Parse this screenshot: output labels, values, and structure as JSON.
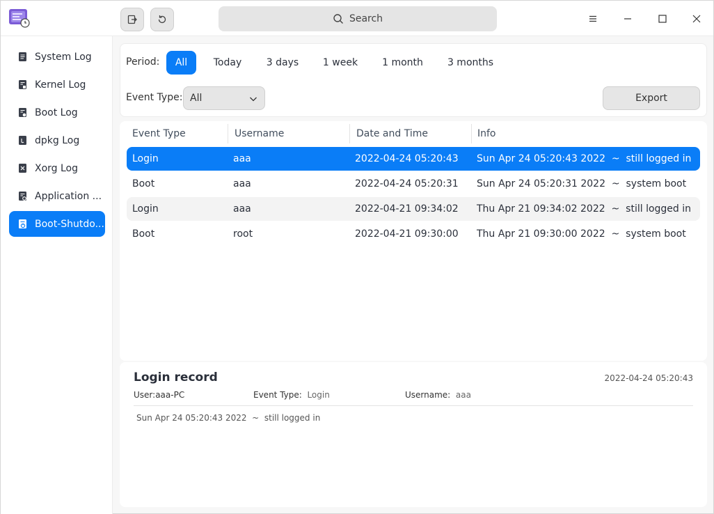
{
  "toolbar": {
    "search_placeholder": "Search"
  },
  "sidebar": {
    "items": [
      {
        "label": "System Log",
        "icon": "system-log-icon"
      },
      {
        "label": "Kernel Log",
        "icon": "kernel-log-icon"
      },
      {
        "label": "Boot Log",
        "icon": "boot-log-icon"
      },
      {
        "label": "dpkg Log",
        "icon": "dpkg-log-icon"
      },
      {
        "label": "Xorg Log",
        "icon": "xorg-log-icon"
      },
      {
        "label": "Application ...",
        "icon": "application-log-icon"
      },
      {
        "label": "Boot-Shutdo...",
        "icon": "boot-shutdown-log-icon",
        "active": true
      }
    ]
  },
  "filter": {
    "period_label": "Period:",
    "periods": [
      "All",
      "Today",
      "3 days",
      "1 week",
      "1 month",
      "3 months"
    ],
    "selected_period": "All",
    "event_type_label": "Event Type:",
    "event_type_value": "All",
    "export_label": "Export"
  },
  "table": {
    "headers": [
      "Event Type",
      "Username",
      "Date and Time",
      "Info"
    ],
    "rows": [
      {
        "event": "Login",
        "user": "aaa",
        "datetime": "2022-04-24 05:20:43",
        "info": "Sun Apr 24 05:20:43 2022  ~  still logged in",
        "selected": true
      },
      {
        "event": "Boot",
        "user": "aaa",
        "datetime": "2022-04-24 05:20:31",
        "info": "Sun Apr 24 05:20:31 2022  ~  system boot"
      },
      {
        "event": "Login",
        "user": "aaa",
        "datetime": "2022-04-21 09:34:02",
        "info": "Thu Apr 21 09:34:02 2022  ~  still logged in"
      },
      {
        "event": "Boot",
        "user": "root",
        "datetime": "2022-04-21 09:30:00",
        "info": "Thu Apr 21 09:30:00 2022  ~  system boot"
      }
    ]
  },
  "detail": {
    "title": "Login record",
    "time": "2022-04-24 05:20:43",
    "user_label": "User:",
    "user_value": "aaa-PC",
    "event_type_label": "Event Type:",
    "event_type_value": "Login",
    "username_label": "Username:",
    "username_value": "aaa",
    "info": "Sun Apr 24 05:20:43 2022  ~  still logged in"
  },
  "colors": {
    "accent": "#0a7df7"
  }
}
